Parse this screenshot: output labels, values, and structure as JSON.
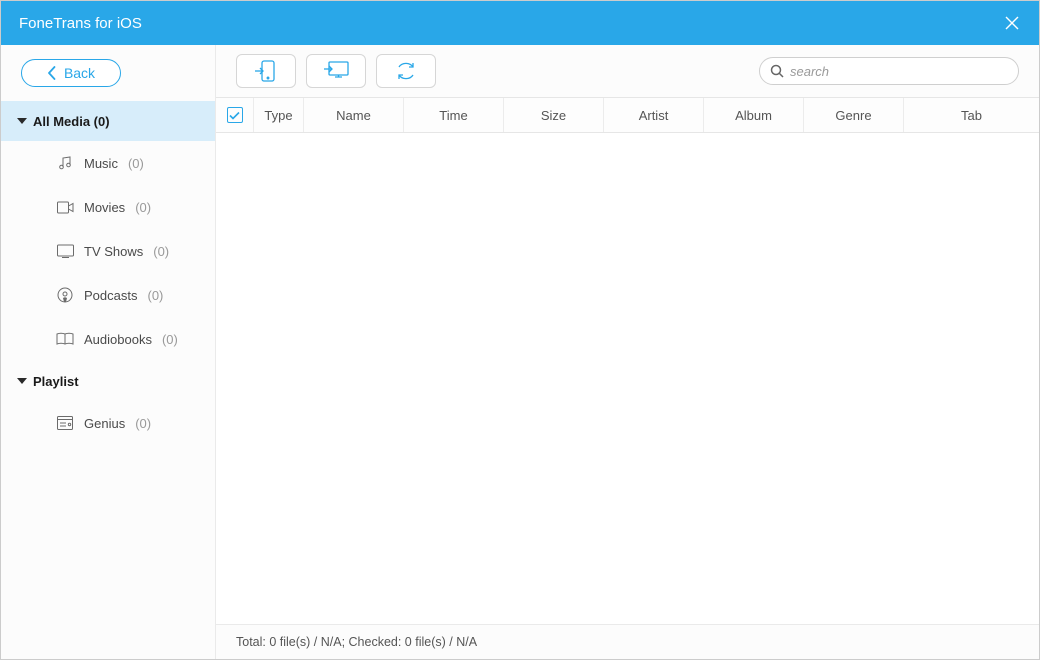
{
  "window": {
    "title": "FoneTrans for iOS"
  },
  "back_label": "Back",
  "search": {
    "placeholder": "search"
  },
  "sidebar": {
    "groups": [
      {
        "label": "All Media (0)",
        "active": true,
        "items": [
          {
            "label": "Music",
            "count": "(0)",
            "icon": "music-note-icon"
          },
          {
            "label": "Movies",
            "count": "(0)",
            "icon": "movie-icon"
          },
          {
            "label": "TV Shows",
            "count": "(0)",
            "icon": "tv-icon"
          },
          {
            "label": "Podcasts",
            "count": "(0)",
            "icon": "podcast-icon"
          },
          {
            "label": "Audiobooks",
            "count": "(0)",
            "icon": "audiobook-icon"
          }
        ]
      },
      {
        "label": "Playlist",
        "active": false,
        "items": [
          {
            "label": "Genius",
            "count": "(0)",
            "icon": "genius-icon"
          }
        ]
      }
    ]
  },
  "columns": {
    "type": "Type",
    "name": "Name",
    "time": "Time",
    "size": "Size",
    "artist": "Artist",
    "album": "Album",
    "genre": "Genre",
    "tab": "Tab"
  },
  "statusbar": "Total: 0 file(s) / N/A; Checked: 0 file(s) / N/A"
}
